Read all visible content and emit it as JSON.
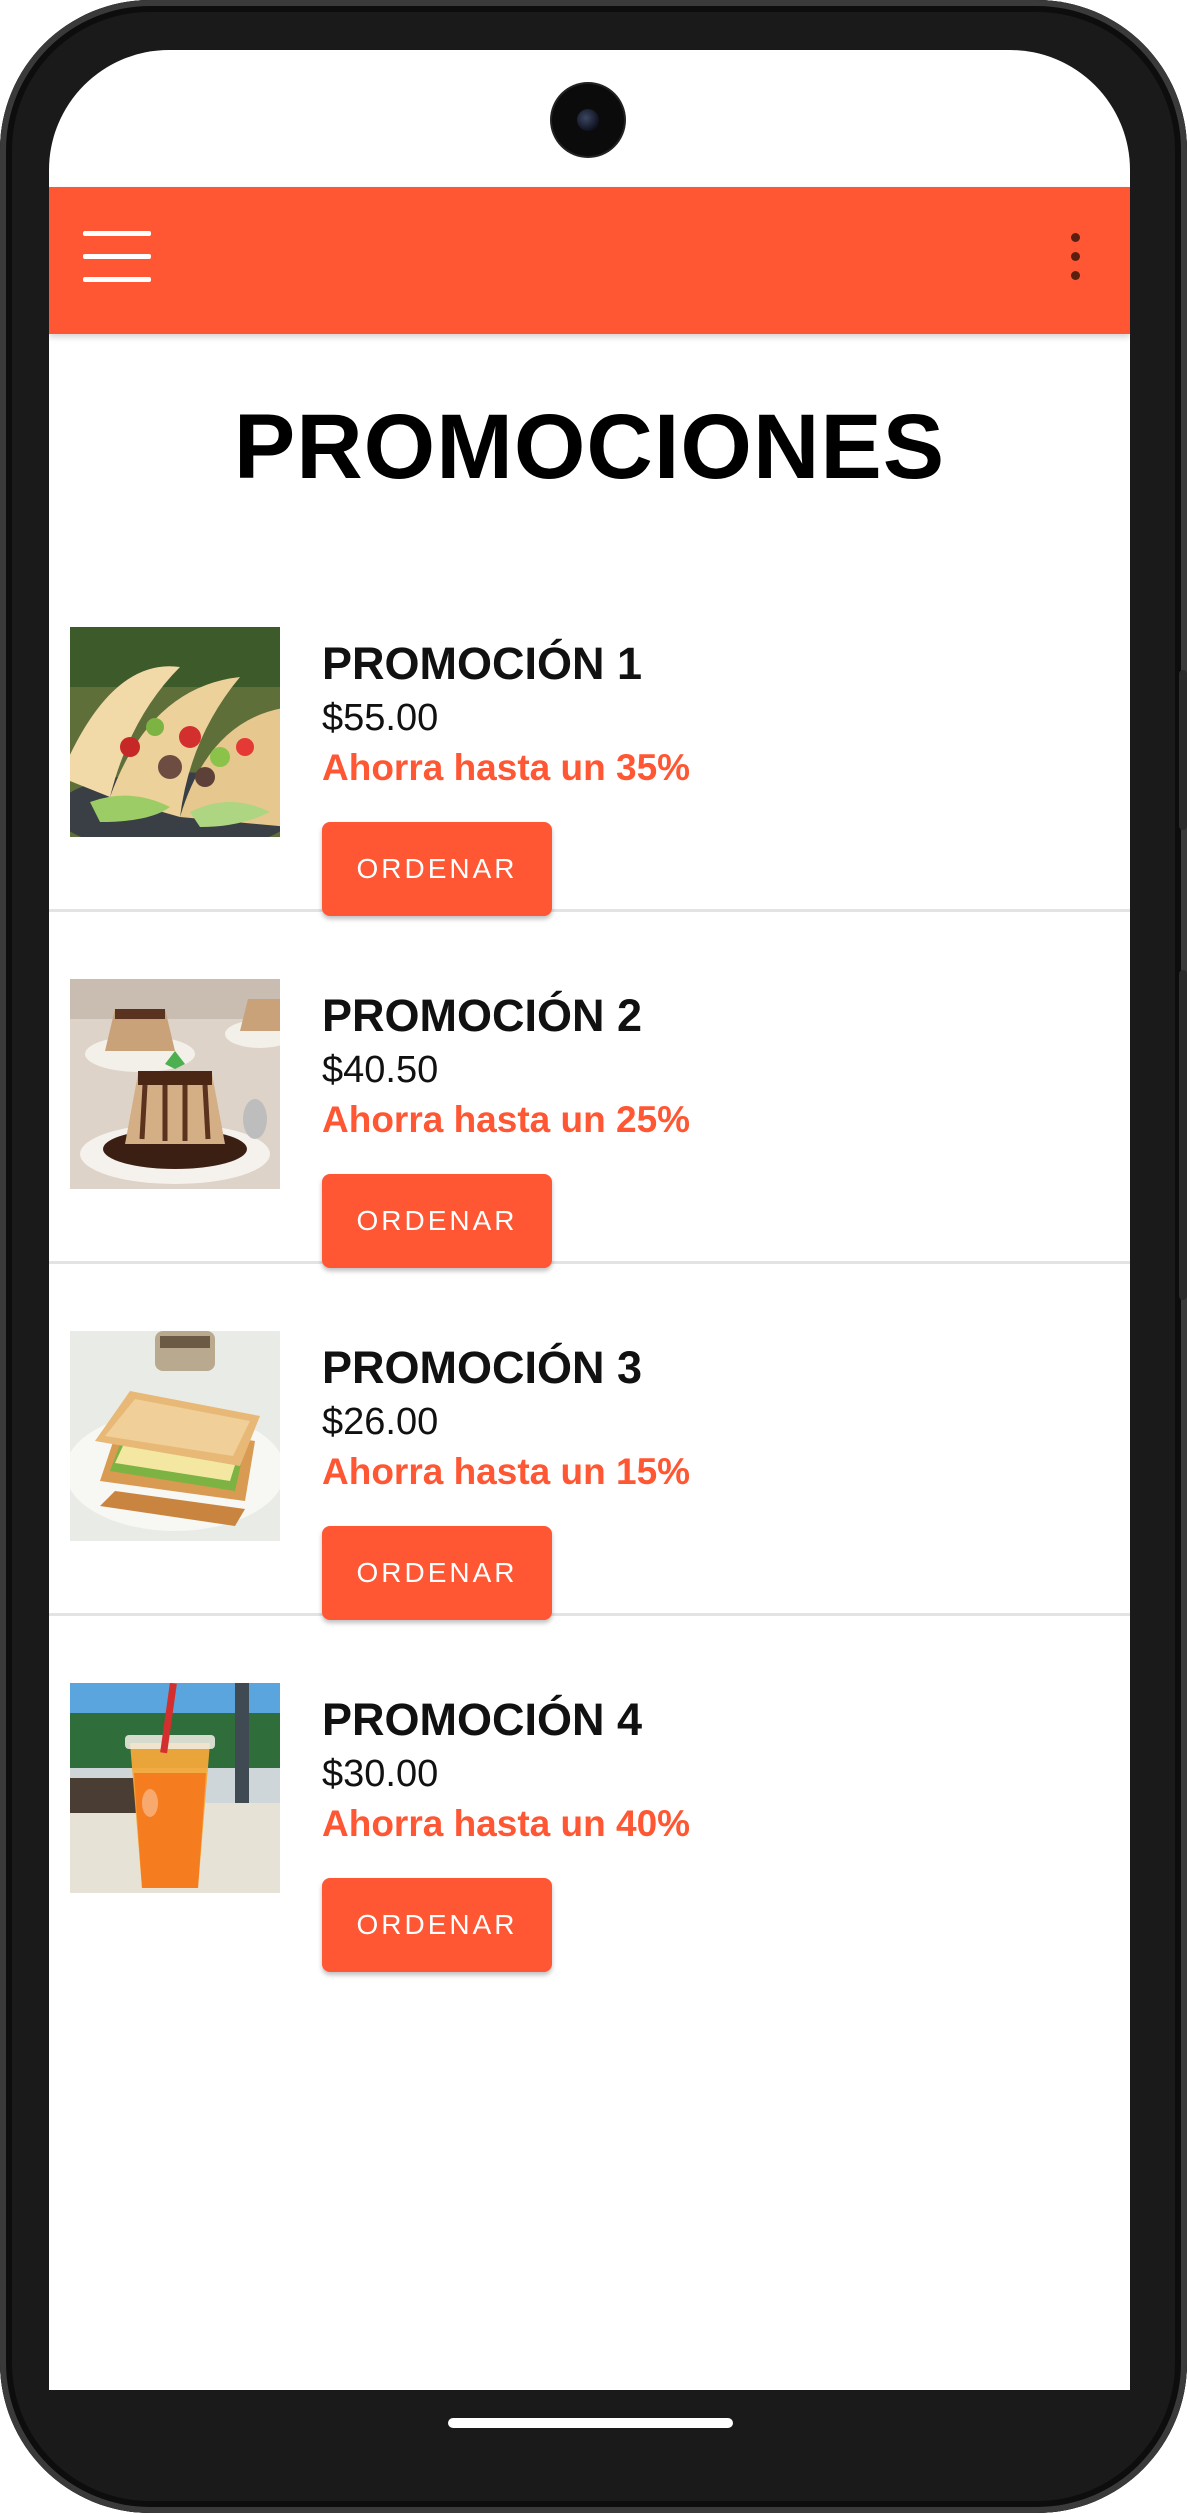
{
  "app": {
    "title": "PROMOCIONES",
    "accent_color": "#ff5733",
    "menu_icon": "hamburger-menu-icon",
    "overflow_icon": "more-vert-icon"
  },
  "promotions": [
    {
      "title": "PROMOCIÓN 1",
      "price": "$55.00",
      "savings": "Ahorra hasta un 35%",
      "button": "ORDENAR",
      "image": "tacos-image"
    },
    {
      "title": "PROMOCIÓN 2",
      "price": "$40.50",
      "savings": "Ahorra hasta un 25%",
      "button": "ORDENAR",
      "image": "flan-dessert-image"
    },
    {
      "title": "PROMOCIÓN 3",
      "price": "$26.00",
      "savings": "Ahorra hasta un 15%",
      "button": "ORDENAR",
      "image": "sandwich-image"
    },
    {
      "title": "PROMOCIÓN 4",
      "price": "$30.00",
      "savings": "Ahorra hasta un 40%",
      "button": "ORDENAR",
      "image": "iced-drink-image"
    }
  ]
}
